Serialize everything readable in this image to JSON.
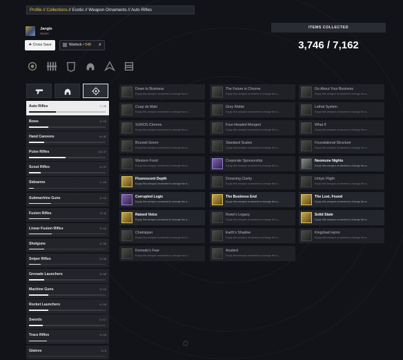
{
  "breadcrumb": {
    "link": "Profile // Collections",
    "rest": " // Exotic // Weapon Ornaments // Auto Rifles"
  },
  "profile": {
    "name": "Jangle",
    "subtitle": "Steam",
    "cross_save_label": "Cross Save",
    "character_label": "Warlock",
    "character_power": "• 548"
  },
  "collection": {
    "label": "ITEMS COLLECTED",
    "count": "3,746 / 7,162"
  },
  "category_icons": [
    "ornament-icon",
    "weapon-rack-icon",
    "armor-icon",
    "helmet-icon",
    "ship-icon",
    "emblem-icon"
  ],
  "type_tabs": [
    {
      "icon": "pistol-icon"
    },
    {
      "icon": "helmet-icon"
    },
    {
      "icon": "crosshair-icon",
      "active": true
    }
  ],
  "weapons": [
    {
      "name": "Auto Rifles",
      "count": "7 / 20",
      "progress": 0.35,
      "selected": true
    },
    {
      "name": "Bows",
      "count": "4 / 16",
      "progress": 0.25
    },
    {
      "name": "Hand Cannons",
      "count": "8 / 41",
      "progress": 0.2
    },
    {
      "name": "Pulse Rifles",
      "count": "13 / 27",
      "progress": 0.48
    },
    {
      "name": "Scout Rifles",
      "count": "4 / 27",
      "progress": 0.15
    },
    {
      "name": "Sidearms",
      "count": "1 / 16",
      "progress": 0.06
    },
    {
      "name": "Submachine Guns",
      "count": "4 / 14",
      "progress": 0.29
    },
    {
      "name": "Fusion Rifles",
      "count": "3 / 11",
      "progress": 0.27
    },
    {
      "name": "Linear Fusion Rifles",
      "count": "3 / 10",
      "progress": 0.3
    },
    {
      "name": "Shotguns",
      "count": "4 / 20",
      "progress": 0.2
    },
    {
      "name": "Sniper Rifles",
      "count": "3 / 20",
      "progress": 0.15
    },
    {
      "name": "Grenade Launchers",
      "count": "3 / 15",
      "progress": 0.2
    },
    {
      "name": "Machine Guns",
      "count": "3 / 12",
      "progress": 0.25
    },
    {
      "name": "Rocket Launchers",
      "count": "4 / 16",
      "progress": 0.25
    },
    {
      "name": "Swords",
      "count": "3 / 17",
      "progress": 0.18
    },
    {
      "name": "Trace Rifles",
      "count": "3 / 13",
      "progress": 0.23
    },
    {
      "name": "Glaives",
      "count": "0 / 3",
      "progress": 0.0
    }
  ],
  "ornament_desc": "Equip this weapon ornament to change the a...",
  "ornament_columns": [
    [
      {
        "title": "Down to Business",
        "icon": "dim",
        "new": false
      },
      {
        "title": "Coup de Main",
        "icon": "dim",
        "new": false
      },
      {
        "title": "SUROS Chrome",
        "icon": "dim",
        "new": false
      },
      {
        "title": "Brunsel Green",
        "icon": "dim",
        "new": false
      },
      {
        "title": "Western Front",
        "icon": "dim",
        "new": false
      },
      {
        "title": "Fluorescent Depth",
        "icon": "gold",
        "new": true
      },
      {
        "title": "Corrupted Logic",
        "icon": "purple",
        "new": true
      },
      {
        "title": "Raised Voice",
        "icon": "gold",
        "new": true
      },
      {
        "title": "Chatnipper",
        "icon": "dim",
        "new": false
      },
      {
        "title": "Komodo's Fear",
        "icon": "dim",
        "new": false
      }
    ],
    [
      {
        "title": "The Future is Chrome",
        "icon": "dim",
        "new": false
      },
      {
        "title": "Grey Kibble",
        "icon": "dim",
        "new": false
      },
      {
        "title": "Four-Headed Mongrel",
        "icon": "dim",
        "new": false
      },
      {
        "title": "Standard Scales",
        "icon": "dim",
        "new": false
      },
      {
        "title": "Corporate Sponsorship",
        "icon": "purple",
        "new": false
      },
      {
        "title": "Drowning Clarity",
        "icon": "dim",
        "new": false
      },
      {
        "title": "The Business End",
        "icon": "gold",
        "new": true
      },
      {
        "title": "Rowe's Legacy",
        "icon": "dim",
        "new": false
      },
      {
        "title": "Earth's Shadow",
        "icon": "dim",
        "new": false
      },
      {
        "title": "Anubird",
        "icon": "dim",
        "new": false
      }
    ],
    [
      {
        "title": "Go About Your Business",
        "icon": "dim",
        "new": false
      },
      {
        "title": "Lethal System",
        "icon": "dim",
        "new": false
      },
      {
        "title": "What If",
        "icon": "dim",
        "new": false
      },
      {
        "title": "Foundational Structure",
        "icon": "dim",
        "new": false
      },
      {
        "title": "Neomune Nights",
        "icon": "grey",
        "new": true
      },
      {
        "title": "Ichtyic Flight",
        "icon": "dim",
        "new": false
      },
      {
        "title": "The Lost, Found",
        "icon": "gold",
        "new": true
      },
      {
        "title": "Solid State",
        "icon": "gold",
        "new": true
      },
      {
        "title": "Kingsbad Hymn",
        "icon": "dim",
        "new": false
      }
    ]
  ]
}
